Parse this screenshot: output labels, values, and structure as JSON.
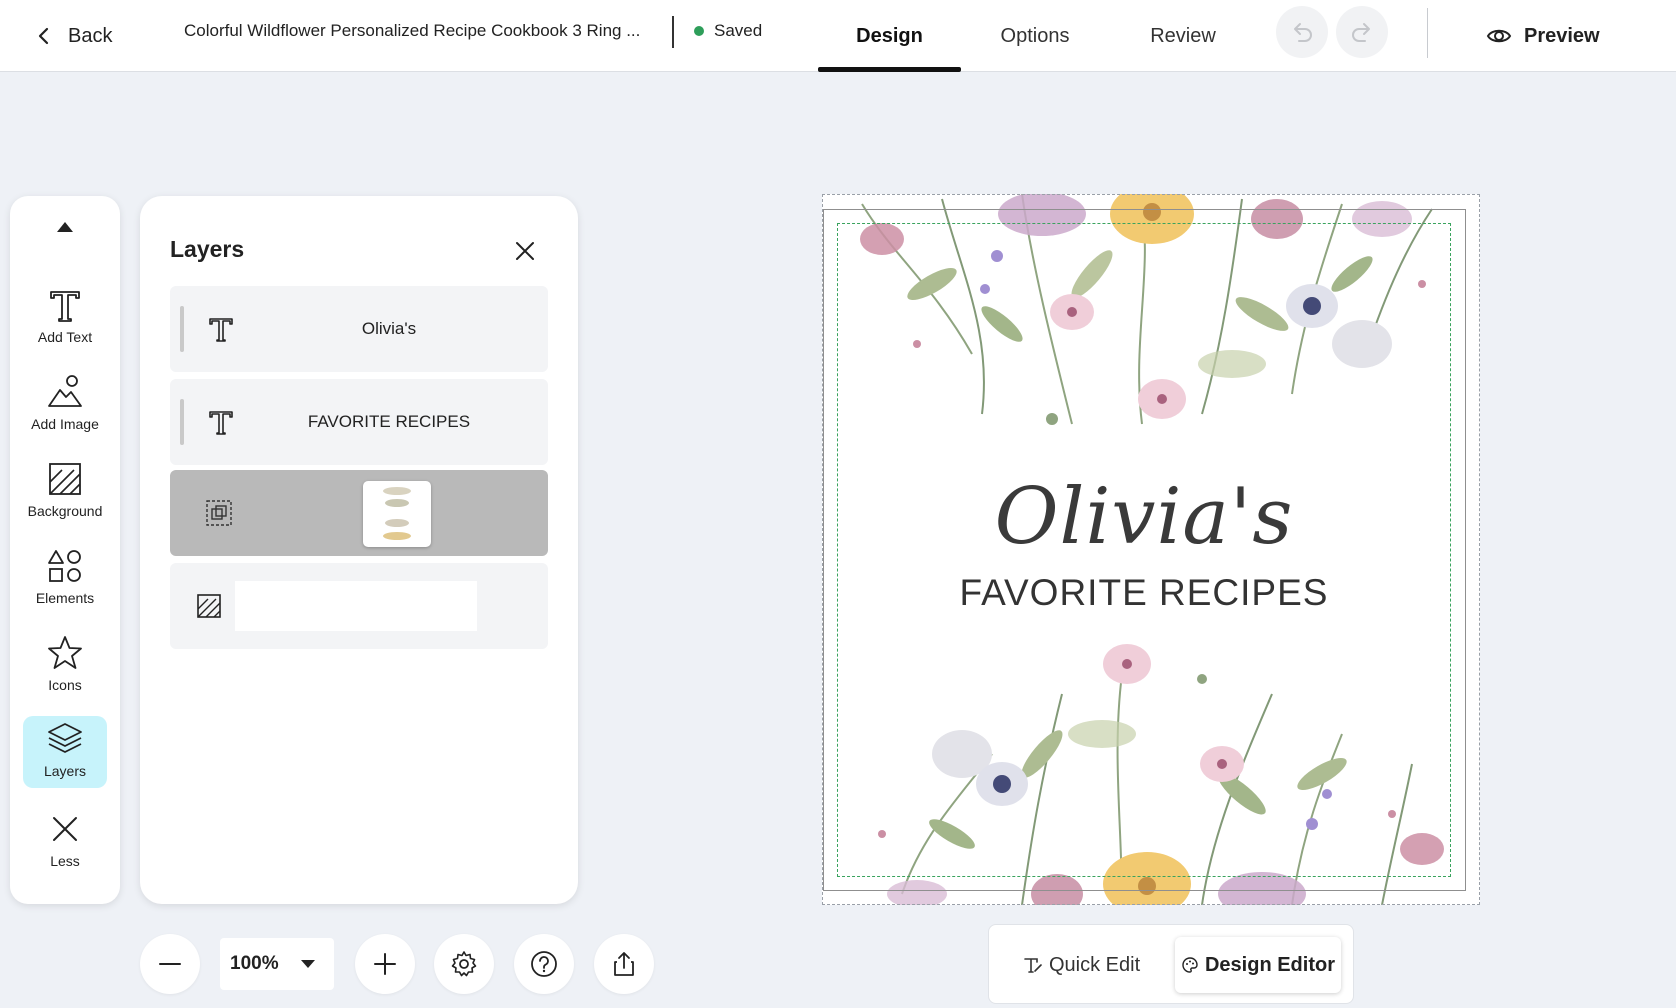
{
  "header": {
    "back_label": "Back",
    "doc_title": "Colorful Wildflower Personalized Recipe Cookbook 3 Ring ...",
    "status_label": "Saved",
    "tabs": [
      {
        "label": "Design",
        "active": true
      },
      {
        "label": "Options",
        "active": false
      },
      {
        "label": "Review",
        "active": false
      }
    ],
    "undo_icon": "undo-icon",
    "redo_icon": "redo-icon",
    "preview_label": "Preview"
  },
  "toolrail": {
    "items": [
      {
        "label": "Add Text",
        "icon": "text-icon"
      },
      {
        "label": "Add Image",
        "icon": "image-add-icon"
      },
      {
        "label": "Background",
        "icon": "background-icon"
      },
      {
        "label": "Elements",
        "icon": "shapes-icon"
      },
      {
        "label": "Icons",
        "icon": "star-icon"
      },
      {
        "label": "Layers",
        "icon": "layers-icon",
        "active": true
      },
      {
        "label": "Less",
        "icon": "close-icon"
      }
    ]
  },
  "layers_panel": {
    "title": "Layers",
    "layers": [
      {
        "type": "text",
        "label": "Olivia's"
      },
      {
        "type": "text",
        "label": "FAVORITE RECIPES"
      },
      {
        "type": "group",
        "label": "",
        "selected": true
      },
      {
        "type": "background",
        "label": ""
      }
    ]
  },
  "zoom": {
    "value": "100%"
  },
  "canvas": {
    "title": "Olivia's",
    "subtitle": "FAVORITE RECIPES"
  },
  "editor_switch": {
    "quick_edit_label": "Quick Edit",
    "design_editor_label": "Design Editor"
  },
  "colors": {
    "saved_dot": "#2e9e5a",
    "active_tool_bg": "#c7f3fb",
    "safe_area": "#3aa35e"
  }
}
